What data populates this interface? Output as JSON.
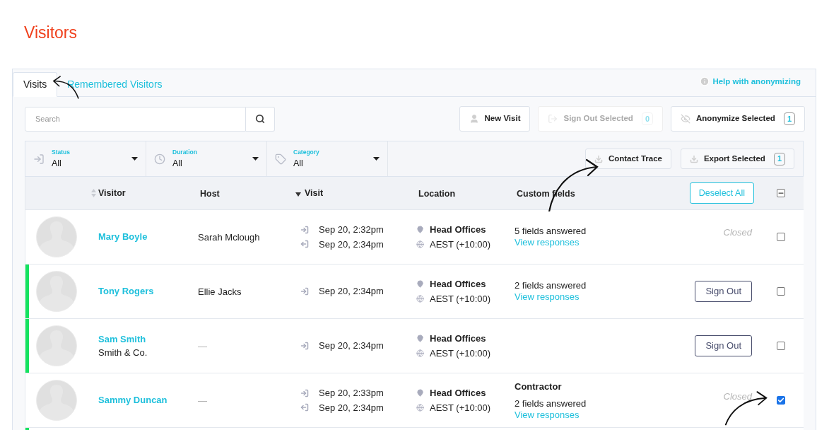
{
  "page_title": "Visitors",
  "tabs": [
    {
      "label": "Visits",
      "selected": true
    },
    {
      "label": "Remembered Visitors",
      "selected": false
    }
  ],
  "help_link": "Help with anonymizing",
  "search": {
    "placeholder": "Search"
  },
  "toolbar": [
    {
      "kind": "new",
      "label": "New Visit",
      "disabled": false
    },
    {
      "kind": "signout",
      "label": "Sign Out Selected",
      "count": "0",
      "disabled": true
    },
    {
      "kind": "anonymize",
      "label": "Anonymize Selected",
      "count": "1",
      "disabled": false
    }
  ],
  "filters": [
    {
      "kind": "status",
      "label": "Status",
      "value": "All"
    },
    {
      "kind": "duration",
      "label": "Duration",
      "value": "All"
    },
    {
      "kind": "category",
      "label": "Category",
      "value": "All"
    }
  ],
  "filter_actions": [
    {
      "label": "Contact Trace"
    },
    {
      "label": "Export Selected",
      "count": "1"
    }
  ],
  "table": {
    "columns": [
      "Visitor",
      "Host",
      "Visit",
      "Location",
      "Custom fields"
    ],
    "deselect_label": "Deselect All",
    "header_indeterminate": true,
    "rows": [
      {
        "name": "Mary Boyle",
        "company": "",
        "host": "Sarah Mclough",
        "signed_in": false,
        "times": [
          {
            "kind": "in",
            "time": "Sep 20, 2:32pm"
          },
          {
            "kind": "out",
            "time": "Sep 20, 2:34pm"
          }
        ],
        "location": "Head Offices",
        "timezone": "AEST (+10:00)",
        "category": "",
        "fields": "5 fields answered",
        "responses": "View responses",
        "action": {
          "kind": "status",
          "label": "Closed"
        },
        "checked": false
      },
      {
        "name": "Tony Rogers",
        "company": "",
        "host": "Ellie Jacks",
        "signed_in": true,
        "times": [
          {
            "kind": "in",
            "time": "Sep 20, 2:34pm"
          }
        ],
        "location": "Head Offices",
        "timezone": "AEST (+10:00)",
        "category": "",
        "fields": "2 fields answered",
        "responses": "View responses",
        "action": {
          "kind": "button",
          "label": "Sign Out"
        },
        "checked": false
      },
      {
        "name": "Sam Smith",
        "company": "Smith & Co.",
        "host": "—",
        "signed_in": true,
        "times": [
          {
            "kind": "in",
            "time": "Sep 20, 2:34pm"
          }
        ],
        "location": "Head Offices",
        "timezone": "AEST (+10:00)",
        "category": "",
        "fields": "",
        "responses": "",
        "action": {
          "kind": "button",
          "label": "Sign Out"
        },
        "checked": false
      },
      {
        "name": "Sammy Duncan",
        "company": "",
        "host": "—",
        "signed_in": false,
        "times": [
          {
            "kind": "in",
            "time": "Sep 20, 2:33pm"
          },
          {
            "kind": "out",
            "time": "Sep 20, 2:34pm"
          }
        ],
        "location": "Head Offices",
        "timezone": "AEST (+10:00)",
        "category": "Contractor",
        "fields": "2 fields answered",
        "responses": "View responses",
        "action": {
          "kind": "status",
          "label": "Closed"
        },
        "checked": true
      },
      {
        "signed_in": true
      }
    ]
  }
}
